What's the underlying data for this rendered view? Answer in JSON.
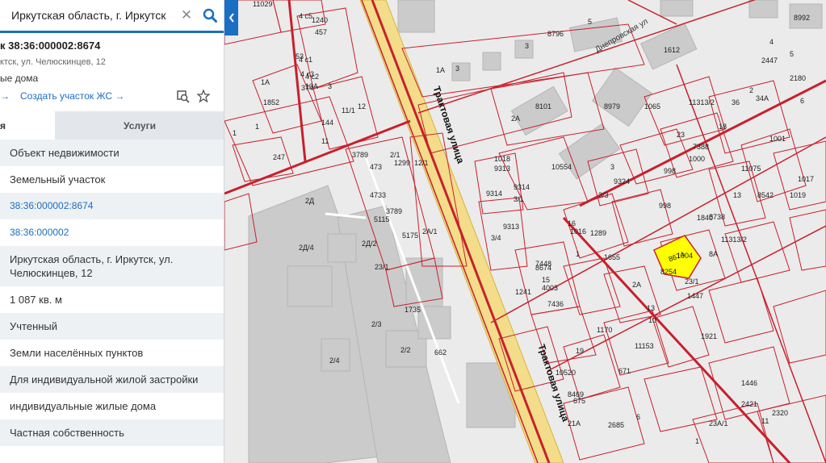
{
  "search": {
    "value": "Иркутская область, г. Иркутск",
    "clear_icon": "close-icon",
    "search_icon": "search-icon"
  },
  "object": {
    "title": "к 38:36:000002:8674",
    "address": "ктск, ул. Челюскинцев, 12",
    "usage": "ые дома"
  },
  "links": {
    "arrow": "→",
    "create": "Создать участок ЖС →"
  },
  "tabs": {
    "info": "я",
    "services": "Услуги"
  },
  "rows": [
    "Объект недвижимости",
    "Земельный участок",
    "38:36:000002:8674",
    "38:36:000002",
    "Иркутская область, г. Иркутск, ул. Челюскинцев, 12",
    "1 087 кв. м",
    "Учтенный",
    "Земли населённых пунктов",
    "Для индивидуальной жилой застройки",
    "индивидуальные жилые дома",
    "Частная собственность"
  ],
  "map": {
    "road_name": "Трактовая улица",
    "street_dneprovskaya": "Днепровская ул",
    "highlight_parcel": "8674",
    "highlight_color": "#ffff00",
    "line_color": "#c8202c",
    "road_fill": "#f3dd8a",
    "labels": [
      "11029",
      "1240",
      "4 с5",
      "4 с1",
      "457",
      "53",
      "4 с3",
      "10А",
      "374",
      "4 с2",
      "3",
      "1А",
      "1852",
      "1",
      "144",
      "11/1",
      "12",
      "11",
      "247",
      "1",
      "3789",
      "473",
      "2/1",
      "1299",
      "12/1",
      "2Д",
      "4733",
      "5115",
      "3789",
      "5175",
      "2А/1",
      "2Д/4",
      "2Д/2",
      "2/3",
      "2/4",
      "2/2",
      "1А",
      "3",
      "3",
      "8796",
      "5",
      "1612",
      "8992",
      "2447",
      "2180",
      "4",
      "5",
      "2",
      "34А",
      "36",
      "6",
      "8101",
      "2А",
      "8979",
      "1065",
      "11313/2",
      "18",
      "1001",
      "23",
      "7388",
      "1000",
      "10554",
      "1018",
      "9313",
      "9314",
      "3/1",
      "9314",
      "3/4",
      "9313",
      "3",
      "9324",
      "3/3",
      "998",
      "998",
      "11075",
      "13",
      "8542",
      "1019",
      "1017",
      "1840",
      "8738",
      "16",
      "1016",
      "1289",
      "1",
      "1655",
      "11313/2",
      "8А",
      "1004",
      "7448",
      "1241",
      "8674",
      "15",
      "4003",
      "7436",
      "2А",
      "8254",
      "1447",
      "23/1",
      "1921",
      "10",
      "13",
      "1170",
      "11153",
      "10520",
      "19",
      "671",
      "1446",
      "2421",
      "11",
      "2320",
      "8469",
      "675",
      "6",
      "21А",
      "2685",
      "1",
      "23А/1",
      "23/1",
      "1735",
      "662"
    ]
  }
}
